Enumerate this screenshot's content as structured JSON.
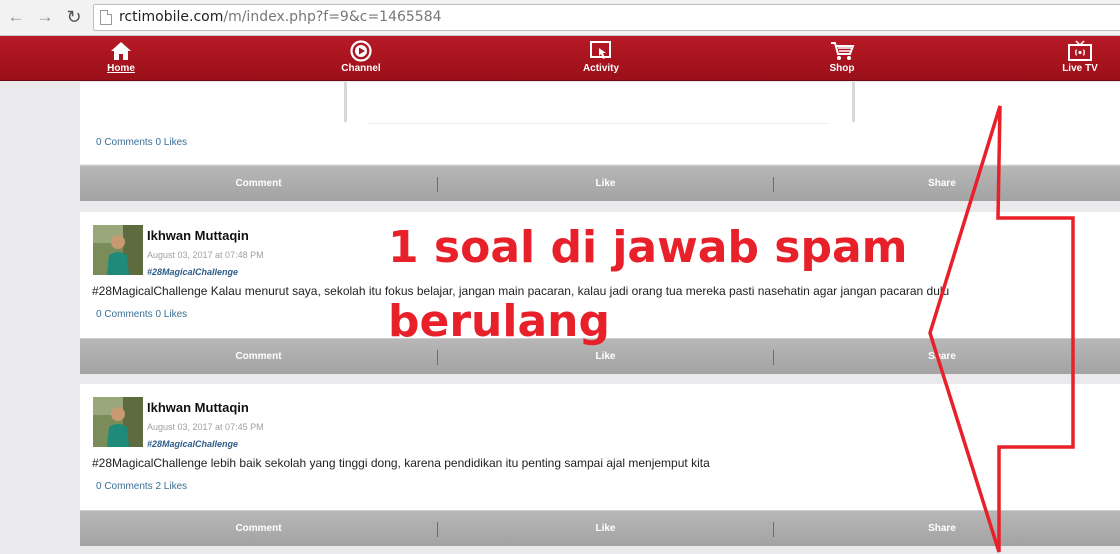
{
  "browser": {
    "url_host": "rctimobile.com",
    "url_path": "/m/index.php?f=9&c=1465584",
    "back_icon": "back-arrow-icon",
    "forward_icon": "forward-arrow-icon",
    "reload_icon": "reload-icon"
  },
  "nav": {
    "items": [
      {
        "label": "Home",
        "icon": "home-icon",
        "active": true
      },
      {
        "label": "Channel",
        "icon": "play-circle-icon"
      },
      {
        "label": "Activity",
        "icon": "touch-screen-icon"
      },
      {
        "label": "Shop",
        "icon": "shopping-cart-icon"
      },
      {
        "label": "Live TV",
        "icon": "tv-icon"
      }
    ]
  },
  "posts": [
    {
      "stats": "0 Comments 0 Likes",
      "actions": [
        "Comment",
        "Like",
        "Share"
      ]
    },
    {
      "author": "Ikhwan Muttaqin",
      "date": "August 03, 2017 at 07:48 PM",
      "tag": "#28MagicalChallenge",
      "text": "#28MagicalChallenge Kalau menurut saya, sekolah itu fokus belajar, jangan main pacaran, kalau jadi orang tua mereka pasti nasehatin agar jangan pacaran dulu",
      "stats": "0 Comments 0 Likes",
      "actions": [
        "Comment",
        "Like",
        "Share"
      ]
    },
    {
      "author": "Ikhwan Muttaqin",
      "date": "August 03, 2017 at 07:45 PM",
      "tag": "#28MagicalChallenge",
      "text": "#28MagicalChallenge lebih baik sekolah yang tinggi dong, karena pendidikan itu penting sampai ajal menjemput kita",
      "stats": "0 Comments 2 Likes",
      "actions": [
        "Comment",
        "Like",
        "Share"
      ]
    }
  ],
  "annotation": {
    "line1": "1 soal di jawab spam",
    "line2": "berulang",
    "color": "#e8202a"
  },
  "colors": {
    "nav_bar": "#b01824",
    "action_bar": "#a9a9a9",
    "link": "#3a6f95"
  }
}
